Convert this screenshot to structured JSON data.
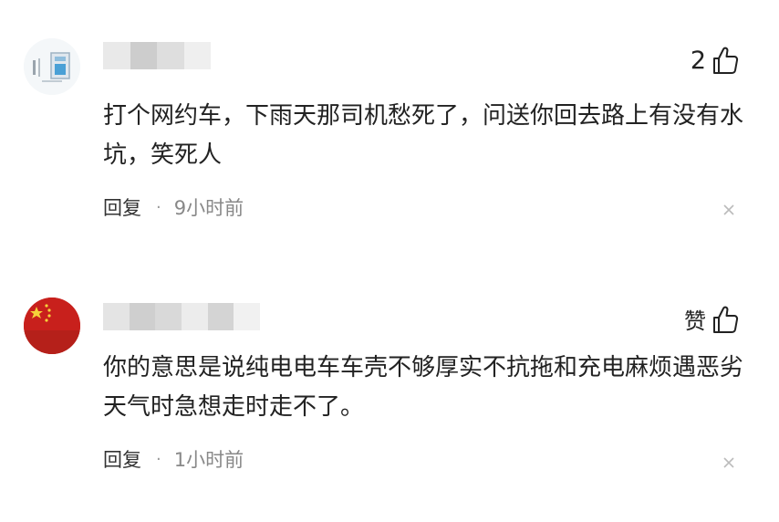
{
  "comments": [
    {
      "avatar_icon": "image-thumbnail-icon",
      "like_label": "2",
      "text": "打个网约车，下雨天那司机愁死了，问送你回去路上有没有水坑，笑死人",
      "reply_label": "回复",
      "separator": "·",
      "time": "9小时前"
    },
    {
      "avatar_icon": "flag-avatar-icon",
      "like_label": "赞",
      "text": "你的意思是说纯电电车车壳不够厚实不抗拖和充电麻烦遇恶劣天气时急想走时走不了。",
      "reply_label": "回复",
      "separator": "·",
      "time": "1小时前"
    }
  ],
  "colors": {
    "text": "#222222",
    "meta": "#888888",
    "blur_light": "#e6e6e6",
    "blur_dark": "#c9c9c9",
    "flag_red": "#c8201c",
    "flag_star": "#f5d13a"
  }
}
